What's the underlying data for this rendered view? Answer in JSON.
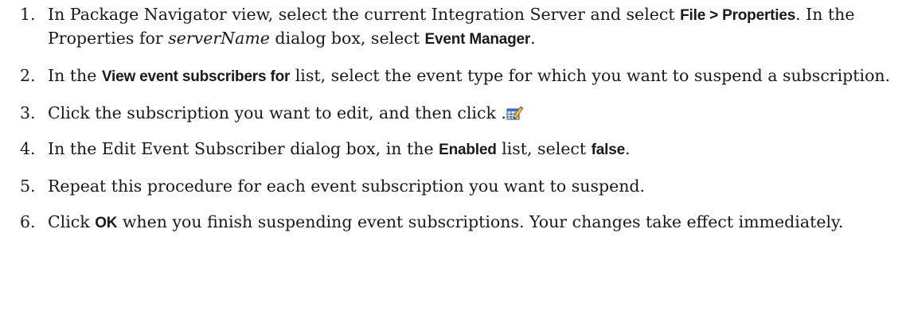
{
  "steps": [
    {
      "number": "1.",
      "parts": [
        {
          "t": "In Package Navigator view, select the current Integration Server and select "
        },
        {
          "t": "File > Properties",
          "s": "ui"
        },
        {
          "t": ". In the Properties for "
        },
        {
          "t": "serverName",
          "s": "var"
        },
        {
          "t": "  dialog box, select "
        },
        {
          "t": "Event Manager",
          "s": "ui"
        },
        {
          "t": "."
        }
      ]
    },
    {
      "number": "2.",
      "parts": [
        {
          "t": "In the "
        },
        {
          "t": "View event subscribers for",
          "s": "ui"
        },
        {
          "t": " list, select the event type for which you want to suspend a subscription."
        }
      ]
    },
    {
      "number": "3.",
      "parts": [
        {
          "t": "Click the subscription you want to edit, and then click ."
        },
        {
          "icon": "edit-icon"
        }
      ]
    },
    {
      "number": "4.",
      "parts": [
        {
          "t": "In the Edit Event Subscriber dialog box, in the "
        },
        {
          "t": "Enabled",
          "s": "ui"
        },
        {
          "t": " list, select "
        },
        {
          "t": "false",
          "s": "ui"
        },
        {
          "t": "."
        }
      ]
    },
    {
      "number": "5.",
      "parts": [
        {
          "t": "Repeat this procedure for each event subscription you want to suspend."
        }
      ]
    },
    {
      "number": "6.",
      "parts": [
        {
          "t": "Click "
        },
        {
          "t": "OK",
          "s": "ui"
        },
        {
          "t": " when you finish suspending event subscriptions. Your changes take effect immediately."
        }
      ]
    }
  ]
}
